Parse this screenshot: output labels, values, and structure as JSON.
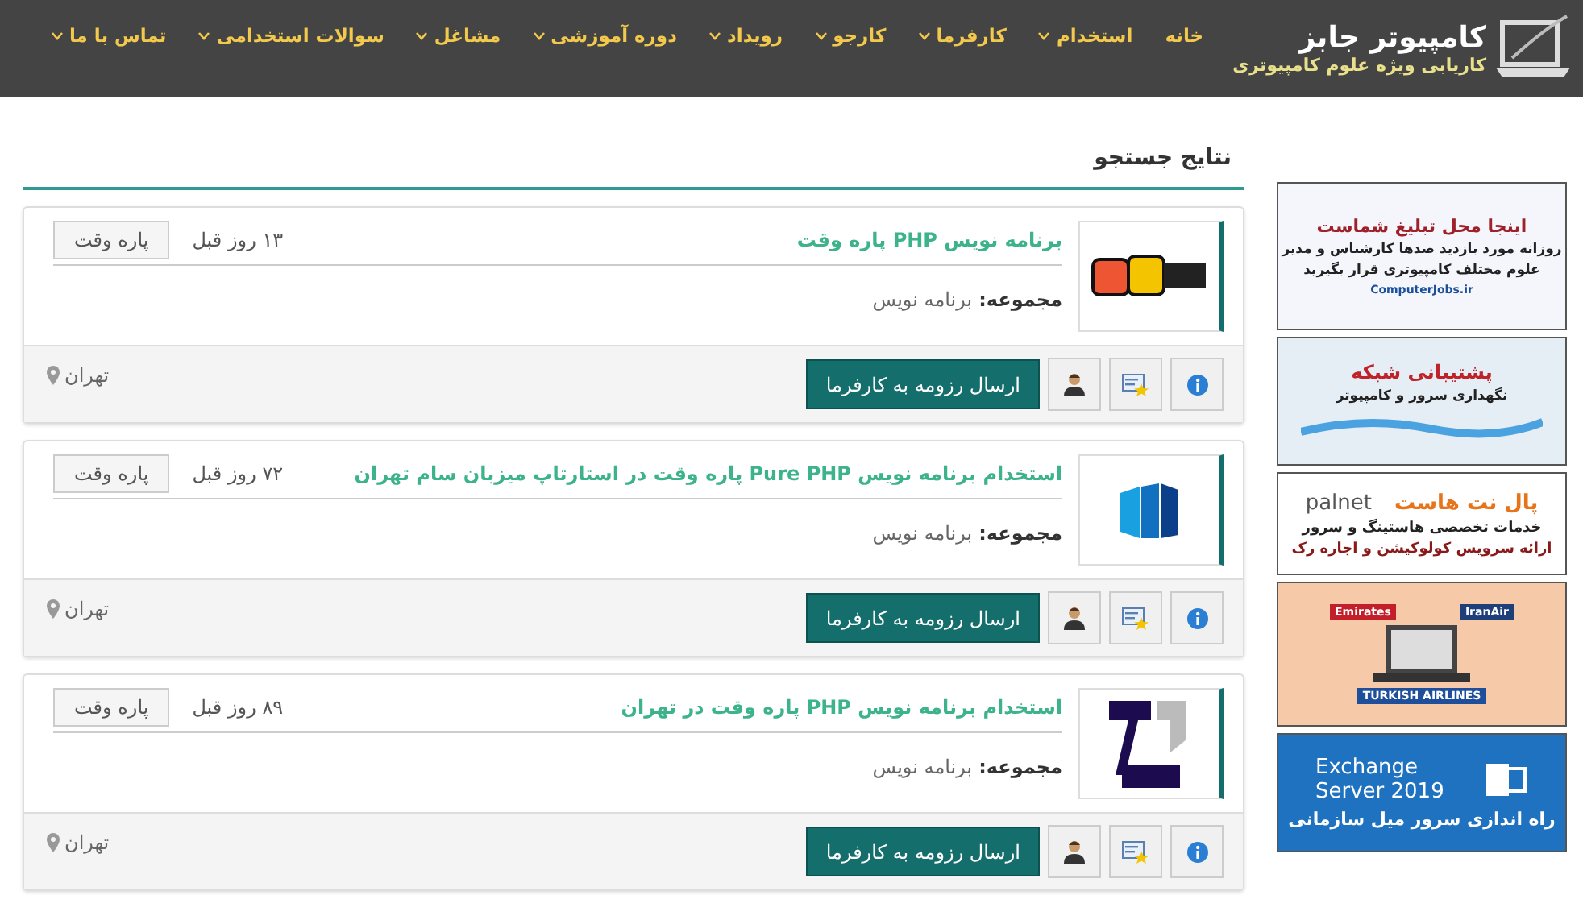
{
  "header": {
    "site_name": "کامپیوتر جابز",
    "tagline": "کاریابی ویژه علوم کامپیوتری",
    "nav": [
      {
        "label": "خانه",
        "dropdown": false
      },
      {
        "label": "استخدام",
        "dropdown": true
      },
      {
        "label": "کارفرما",
        "dropdown": true
      },
      {
        "label": "کارجو",
        "dropdown": true
      },
      {
        "label": "رویداد",
        "dropdown": true
      },
      {
        "label": "دوره آموزشی",
        "dropdown": true
      },
      {
        "label": "مشاغل",
        "dropdown": true
      },
      {
        "label": "سوالات استخدامی",
        "dropdown": true
      },
      {
        "label": "تماس با ما",
        "dropdown": true
      }
    ]
  },
  "results": {
    "title": "نتایج جستجو",
    "jobs": [
      {
        "title": "برنامه نویس PHP پاره وقت",
        "category": "برنامه نویس",
        "age": "۱۳ روز قبل",
        "type": "پاره وقت",
        "apply": "ارسال رزومه به کارفرما",
        "location": "تهران",
        "kind": "bs",
        "category_label": "مجموعه:"
      },
      {
        "title": "استخدام برنامه نویس Pure PHP پاره وقت در استارتاپ میزبان سام تهران",
        "category": "برنامه نویس",
        "age": "۷۲ روز قبل",
        "type": "پاره وقت",
        "apply": "ارسال رزومه به کارفرما",
        "location": "تهران",
        "kind": "blocks",
        "category_label": "مجموعه:"
      },
      {
        "title": "استخدام برنامه نویس PHP پاره وقت در تهران",
        "category": "برنامه نویس",
        "age": "۸۹ روز قبل",
        "type": "پاره وقت",
        "apply": "ارسال رزومه به کارفرما",
        "location": "تهران",
        "kind": "tp",
        "category_label": "مجموعه:"
      }
    ]
  },
  "sidebar": {
    "ads": [
      {
        "kind": "billboard",
        "headline": "اینجا محل تبلیغ شماست",
        "lines": [
          "روزانه مورد بازدید صدها کارشناس و مدیر",
          "علوم مختلف کامپیوتری قرار بگیرید"
        ],
        "footer": "ComputerJobs.ir"
      },
      {
        "kind": "network",
        "headline": "پشتیبانی شبکه",
        "lines": [
          "نگهداری سرور و کامپیوتر"
        ]
      },
      {
        "kind": "hosting",
        "headline": "پال نت هاست",
        "brand": "palnet",
        "lines": [
          "خدمات تخصصی هاستینگ و سرور",
          "ارائه سرویس کولوکیشن و اجاره رک"
        ]
      },
      {
        "kind": "travel",
        "lines": [
          "Emirates",
          "IranAir",
          "TURKISH AIRLINES"
        ]
      },
      {
        "kind": "exchange",
        "headline": "Exchange Server 2019",
        "lines": [
          "راه اندازی سرور میل سازمانی"
        ]
      }
    ]
  }
}
